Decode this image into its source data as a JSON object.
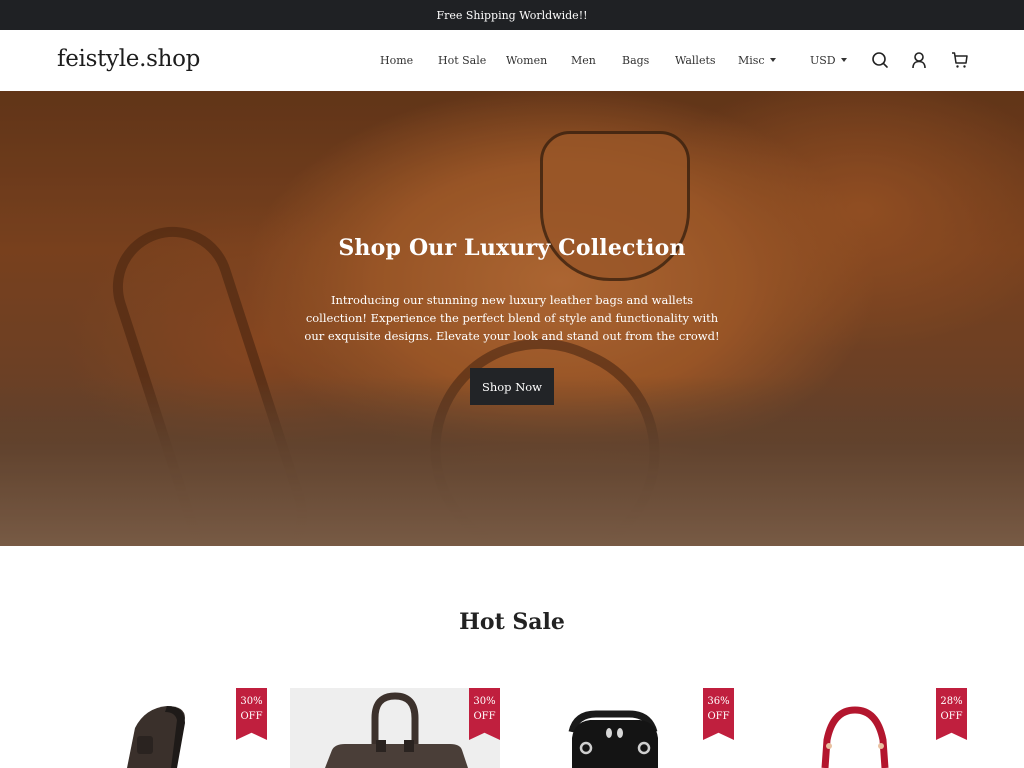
{
  "announcement": "Free Shipping Worldwide!!",
  "header": {
    "logo": "feistyle.shop",
    "nav": [
      {
        "label": "Home"
      },
      {
        "label": "Hot Sale"
      },
      {
        "label": "Women"
      },
      {
        "label": "Men"
      },
      {
        "label": "Bags"
      },
      {
        "label": "Wallets"
      },
      {
        "label": "Misc",
        "has_dropdown": true
      }
    ],
    "currency": "USD",
    "icons": [
      "search-icon",
      "account-icon",
      "cart-icon"
    ]
  },
  "hero": {
    "title": "Shop Our Luxury Collection",
    "text": "Introducing our stunning new luxury leather bags and wallets collection! Experience the perfect blend of style and functionality with our exquisite designs. Elevate your look and stand out from the crowd!",
    "button": "Shop Now"
  },
  "hot_sale": {
    "title": "Hot Sale",
    "products": [
      {
        "discount": "30%",
        "badge_suffix": "OFF",
        "image": "brown-leather-sling-bag"
      },
      {
        "discount": "30%",
        "badge_suffix": "OFF",
        "image": "brown-leather-briefcase"
      },
      {
        "discount": "36%",
        "badge_suffix": "OFF",
        "image": "black-leather-handbag"
      },
      {
        "discount": "28%",
        "badge_suffix": "OFF",
        "image": "red-leather-handbag"
      }
    ]
  },
  "colors": {
    "announcement_bg": "#1f2124",
    "badge": "#c01f3e",
    "button_bg": "#222427"
  }
}
